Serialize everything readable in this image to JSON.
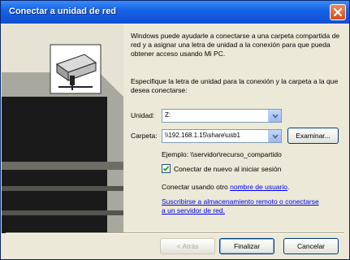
{
  "window": {
    "title": "Conectar a unidad de red"
  },
  "intro": "Windows puede ayudarle a conectarse a una carpeta compartida de red y a asignar una letra de unidad a la conexión para que pueda obtener acceso usando Mi PC.",
  "instruction": "Especifique la letra de unidad para la conexión y la carpeta a la que desea conectarse:",
  "drive": {
    "label": "Unidad:",
    "value": "Z:"
  },
  "folder": {
    "label": "Carpeta:",
    "value": "\\\\192.168.1.15\\share\\usb1",
    "browse_label": "Examinar..."
  },
  "example": "Ejemplo: \\\\servidor\\recurso_compartido",
  "reconnect": {
    "label": "Conectar de nuevo al iniciar sesión",
    "checked": true
  },
  "other_user": {
    "prefix": "Conectar usando otro ",
    "link": "nombre de usuario",
    "suffix": "."
  },
  "storage_link": "Suscribirse a almacenamiento remoto o conectarse a un servidor de red.",
  "buttons": {
    "back": "< Atrás",
    "finish": "Finalizar",
    "cancel": "Cancelar"
  },
  "icons": {
    "close": "close-icon",
    "network-drive": "network-drive-icon",
    "dropdown": "chevron-down-icon",
    "check": "checkmark-icon"
  }
}
